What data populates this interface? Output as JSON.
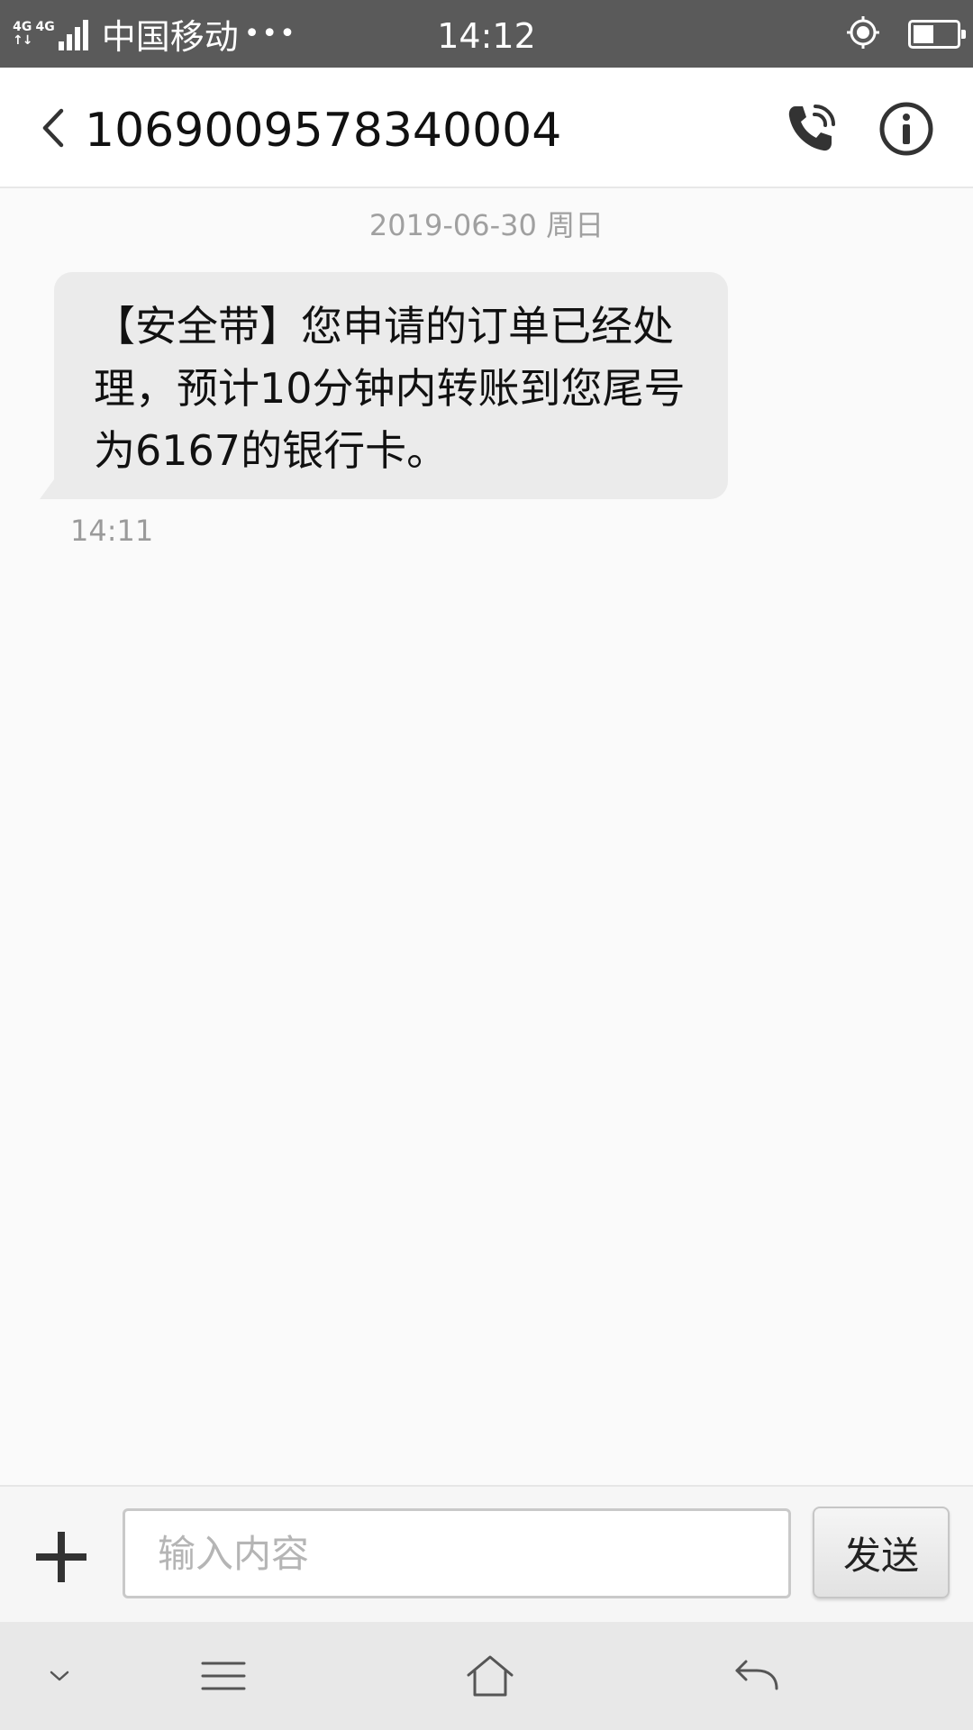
{
  "status_bar": {
    "network_1": "4G",
    "network_2": "4G",
    "carrier": "中国移动",
    "more": "•••",
    "time": "14:12",
    "icons": [
      "signal-icon",
      "location-icon",
      "battery-icon"
    ]
  },
  "app_bar": {
    "title": "1069009578340004",
    "icons": [
      "back-arrow-icon",
      "phone-call-icon",
      "info-icon"
    ]
  },
  "conversation": {
    "date_separator": "2019-06-30 周日",
    "messages": [
      {
        "direction": "incoming",
        "text": "【安全带】您申请的订单已经处理，预计10分钟内转账到您尾号为6167的银行卡。",
        "time": "14:11"
      }
    ]
  },
  "composer": {
    "placeholder": "输入内容",
    "value": "",
    "send_label": "发送",
    "icons": [
      "plus-icon"
    ]
  },
  "nav_bar": {
    "icons": [
      "chevron-down-icon",
      "menu-icon",
      "home-icon",
      "back-icon"
    ]
  },
  "colors": {
    "status_bar_bg": "#5a5a5a",
    "bubble_bg": "#ebebeb",
    "page_bg": "#fafafa",
    "nav_bar_bg": "#e8e8e8"
  }
}
